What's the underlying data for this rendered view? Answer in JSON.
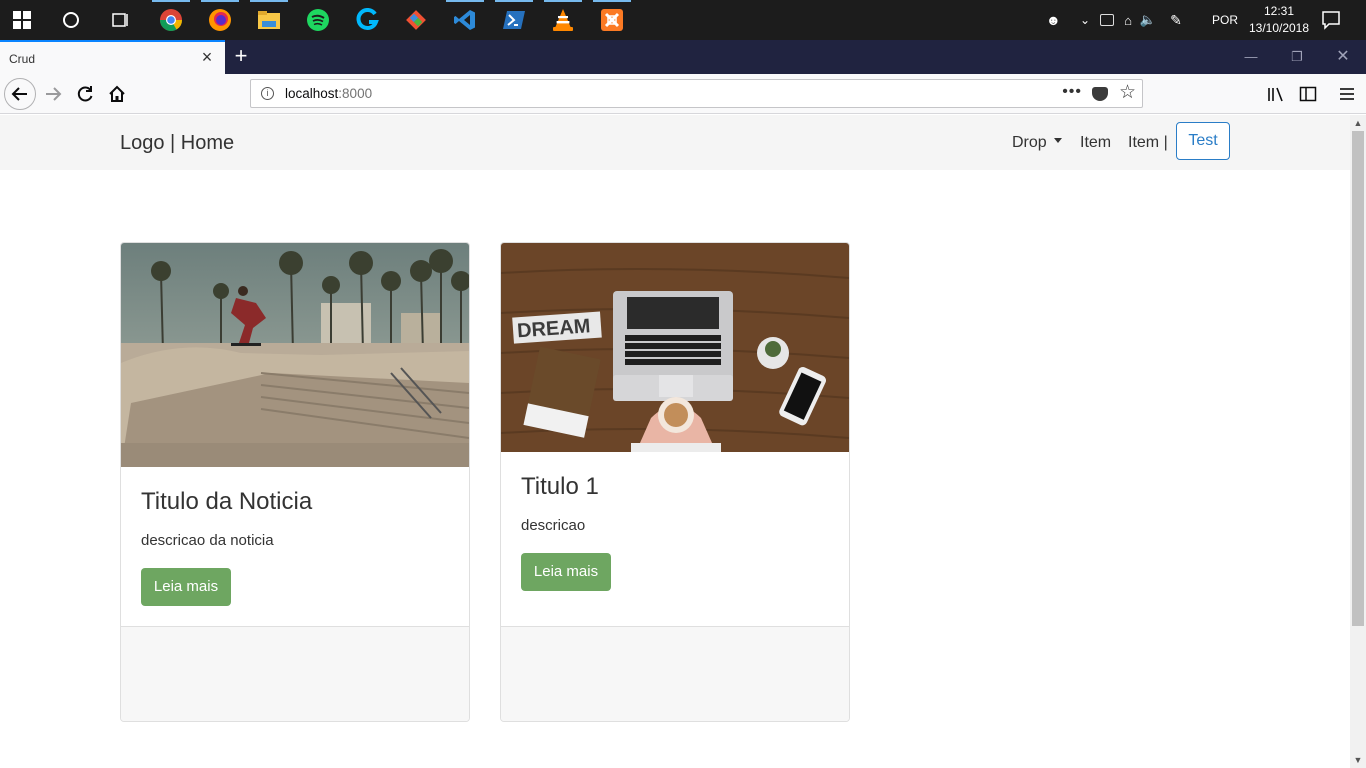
{
  "taskbar": {
    "apps": [
      "start-button",
      "cortana",
      "task-view",
      "chrome",
      "firefox",
      "file-explorer",
      "spotify",
      "logitech",
      "git",
      "vscode",
      "powershell",
      "vlc",
      "xampp"
    ],
    "language": "POR",
    "time": "12:31",
    "date": "13/10/2018"
  },
  "browser": {
    "tab_title": "Crud",
    "url_host": "localhost",
    "url_port": ":8000",
    "url_dots": "•••"
  },
  "site": {
    "brand": "Logo | Home",
    "nav": {
      "drop": "Drop",
      "item1": "Item",
      "item2": "Item |",
      "test": "Test"
    },
    "cards": [
      {
        "title": "Titulo da Noticia",
        "description": "descricao da noticia",
        "button": "Leia mais",
        "image": "skatepark-photo"
      },
      {
        "title": "Titulo 1",
        "description": "descricao",
        "button": "Leia mais",
        "image": "desk-laptop-photo"
      }
    ]
  },
  "colors": {
    "button_green": "#6ea661",
    "link_blue": "#2a7dc7",
    "navbar_bg": "#f5f5f5",
    "taskbar_bg": "#1c1c1c",
    "tabstrip_bg": "#202340"
  }
}
